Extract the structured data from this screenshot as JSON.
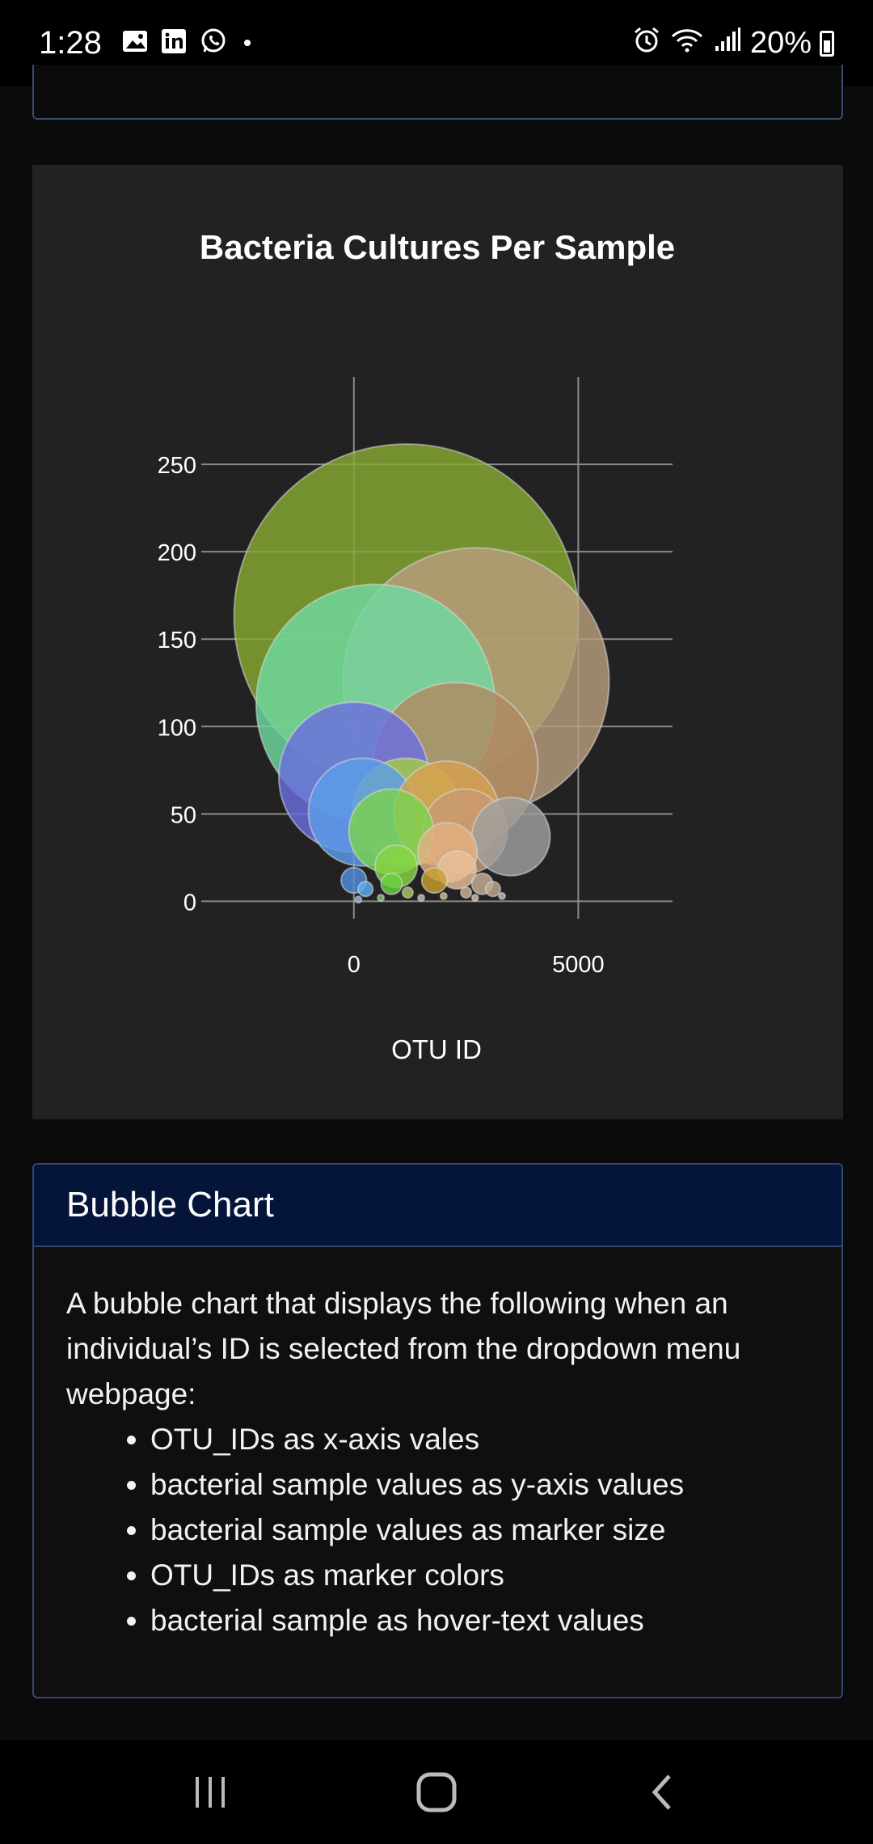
{
  "status_bar": {
    "time": "1:28",
    "battery": "20%",
    "icons": [
      "gallery-icon",
      "linkedin-icon",
      "whatsapp-icon",
      "dot-icon",
      "alarm-icon",
      "wifi-icon",
      "signal-icon",
      "battery-icon"
    ]
  },
  "chart_data": {
    "type": "scatter",
    "title": "Bacteria Cultures Per Sample",
    "xlabel": "OTU ID",
    "ylabel": "",
    "xlim": [
      -3400,
      7100
    ],
    "ylim": [
      -10,
      300
    ],
    "x_ticks": [
      0,
      5000
    ],
    "y_ticks": [
      0,
      50,
      100,
      150,
      200,
      250
    ],
    "grid": true,
    "marker_size_from": "y",
    "points": [
      {
        "x": 1167,
        "y": 163,
        "color": "#86a832"
      },
      {
        "x": 2722,
        "y": 126,
        "color": "#b89e7c"
      },
      {
        "x": 482,
        "y": 113,
        "color": "#6fd9a0"
      },
      {
        "x": 2264,
        "y": 78,
        "color": "#b08a62"
      },
      {
        "x": 3500,
        "y": 37,
        "color": "#a0a0a0"
      },
      {
        "x": 0,
        "y": 71,
        "color": "#6b6ee0"
      },
      {
        "x": 1167,
        "y": 51,
        "color": "#a2cc45"
      },
      {
        "x": 189,
        "y": 51,
        "color": "#5b9ee8"
      },
      {
        "x": 2068,
        "y": 50,
        "color": "#d8a050"
      },
      {
        "x": 2475,
        "y": 40,
        "color": "#c89a72"
      },
      {
        "x": 830,
        "y": 40,
        "color": "#7bd24f"
      },
      {
        "x": 2085,
        "y": 28,
        "color": "#e0b080"
      },
      {
        "x": 941,
        "y": 20,
        "color": "#85d545"
      },
      {
        "x": 2300,
        "y": 18,
        "color": "#e8c09a"
      },
      {
        "x": 1795,
        "y": 12,
        "color": "#c8a030"
      },
      {
        "x": 2860,
        "y": 10,
        "color": "#c8b098"
      },
      {
        "x": 0,
        "y": 12,
        "color": "#4f8fdf"
      },
      {
        "x": 260,
        "y": 7,
        "color": "#5aaef0"
      },
      {
        "x": 840,
        "y": 10,
        "color": "#6ad040"
      },
      {
        "x": 1200,
        "y": 5,
        "color": "#a8c860"
      },
      {
        "x": 2500,
        "y": 5,
        "color": "#d4b090"
      },
      {
        "x": 3100,
        "y": 7,
        "color": "#c0a890"
      },
      {
        "x": 1500,
        "y": 2,
        "color": "#bcbcbc"
      },
      {
        "x": 600,
        "y": 2,
        "color": "#8ac070"
      },
      {
        "x": 3300,
        "y": 3,
        "color": "#c8b8a8"
      },
      {
        "x": 2000,
        "y": 3,
        "color": "#d8b488"
      },
      {
        "x": 100,
        "y": 1,
        "color": "#90b0e0"
      },
      {
        "x": 2700,
        "y": 2,
        "color": "#d0c0b0"
      }
    ]
  },
  "card": {
    "title": "Bubble Chart",
    "intro": "A bubble chart that displays the following when an individual’s ID is selected from the dropdown menu webpage:",
    "items": [
      "OTU_IDs as x-axis vales",
      "bacterial sample values as y-axis values",
      "bacterial sample values as marker size",
      "OTU_IDs as marker colors",
      "bacterial sample as hover-text values"
    ]
  },
  "nav": {
    "buttons": [
      "recent-apps-icon",
      "home-icon",
      "back-icon"
    ]
  }
}
